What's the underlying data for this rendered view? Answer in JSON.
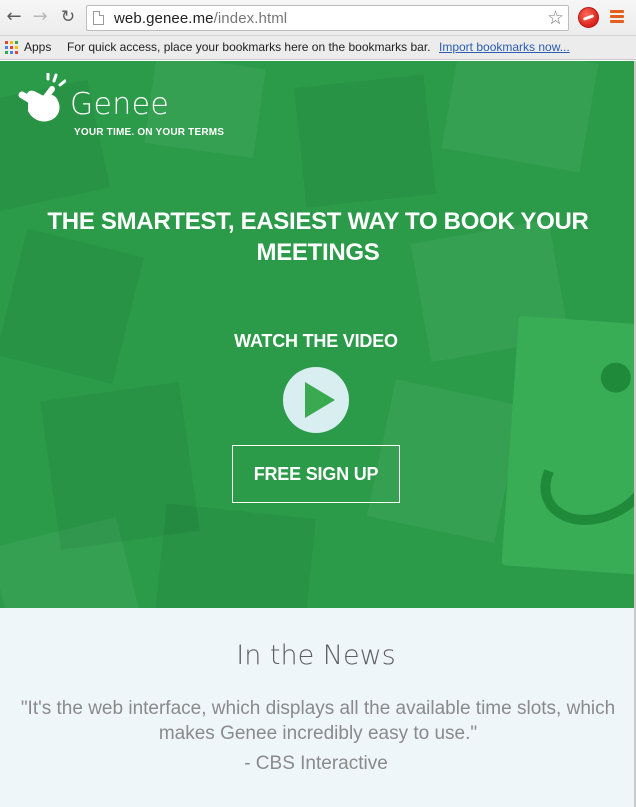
{
  "browser": {
    "url_host": "web.genee.me",
    "url_path": "/index.html",
    "bookmarks": {
      "apps_label": "Apps",
      "hint": "For quick access, place your bookmarks here on the bookmarks bar.",
      "import_link": "Import bookmarks now..."
    },
    "icons": {
      "back": "back-arrow-icon",
      "forward": "forward-arrow-icon",
      "reload": "reload-icon",
      "page": "page-icon",
      "bookmark_star": "star-icon",
      "extension": "extension-icon",
      "menu": "menu-icon",
      "apps": "apps-grid-icon"
    }
  },
  "hero": {
    "logo_name": "Genee",
    "logo_tagline": "YOUR TIME. ON YOUR TERMS",
    "headline": "THE SMARTEST, EASIEST WAY TO BOOK YOUR MEETINGS",
    "watch_label": "WATCH THE VIDEO",
    "play_icon": "play-icon",
    "signup_label": "FREE SIGN UP"
  },
  "news": {
    "title": "In the News",
    "quote": "\"It's the web interface, which displays all the available time slots, which makes Genee incredibly easy to use.\"",
    "source": "- CBS Interactive"
  },
  "colors": {
    "hero_green": "#2b9a49",
    "play_circle": "#d9eef0",
    "play_triangle": "#3aa94f",
    "news_bg": "#eff6fa",
    "menu_orange": "#e4601d"
  }
}
